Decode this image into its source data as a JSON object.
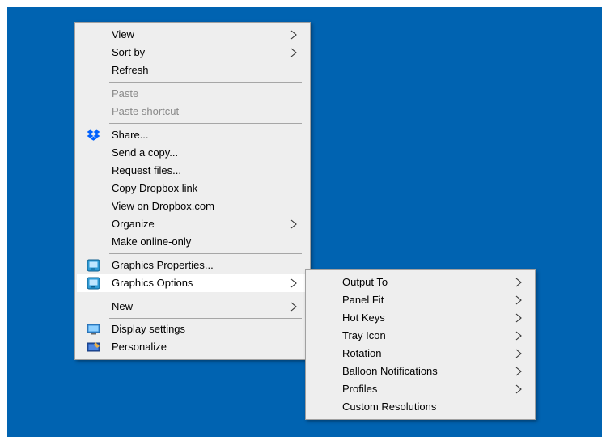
{
  "context_menu": {
    "items": [
      {
        "label": "View"
      },
      {
        "label": "Sort by"
      },
      {
        "label": "Refresh"
      },
      {
        "label": "Paste"
      },
      {
        "label": "Paste shortcut"
      },
      {
        "label": "Share...",
        "icon": "dropbox-icon"
      },
      {
        "label": "Send a copy..."
      },
      {
        "label": "Request files..."
      },
      {
        "label": "Copy Dropbox link"
      },
      {
        "label": "View on Dropbox.com"
      },
      {
        "label": "Organize"
      },
      {
        "label": "Make online-only"
      },
      {
        "label": "Graphics Properties...",
        "icon": "intel-graphics-icon"
      },
      {
        "label": "Graphics Options",
        "icon": "intel-graphics-icon"
      },
      {
        "label": "New"
      },
      {
        "label": "Display settings",
        "icon": "display-icon"
      },
      {
        "label": "Personalize",
        "icon": "personalize-icon"
      }
    ]
  },
  "submenu": {
    "items": [
      {
        "label": "Output To"
      },
      {
        "label": "Panel Fit"
      },
      {
        "label": "Hot Keys"
      },
      {
        "label": "Tray Icon"
      },
      {
        "label": "Rotation"
      },
      {
        "label": "Balloon Notifications"
      },
      {
        "label": "Profiles"
      },
      {
        "label": "Custom Resolutions"
      }
    ]
  },
  "colors": {
    "desktop": "#0063b1",
    "menu_background": "#eeeeee",
    "highlight": "#ffffff",
    "disabled_text": "#8a8a8a"
  }
}
